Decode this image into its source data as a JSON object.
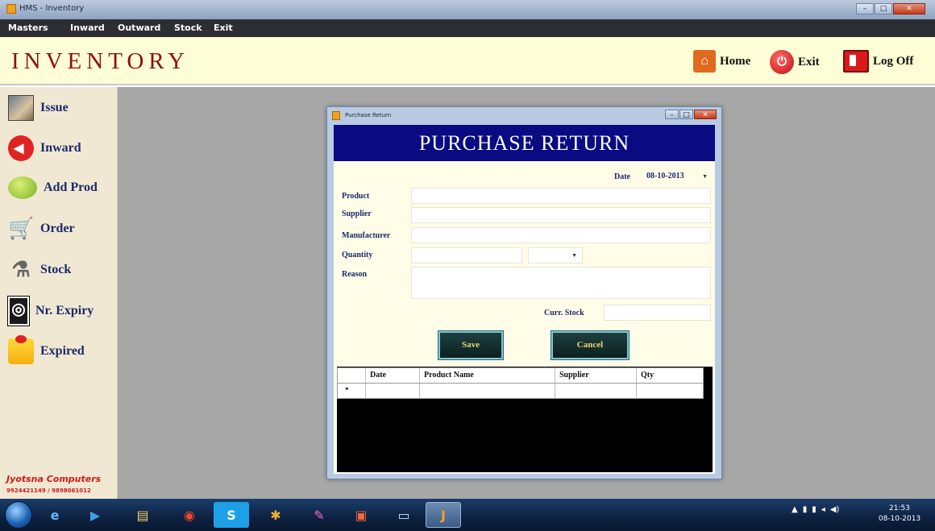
{
  "window": {
    "title": "HMS - Inventory",
    "min": "–",
    "max": "□",
    "close": "✕"
  },
  "menu": [
    "Masters",
    "Inward",
    "Outward",
    "Stock",
    "Exit"
  ],
  "header": {
    "app_title": "INVENTORY",
    "home": "Home",
    "exit": "Exit",
    "logoff": "Log Off"
  },
  "sidebar": {
    "items": [
      {
        "label": "Issue",
        "icon": "issue-icon"
      },
      {
        "label": "Inward",
        "icon": "inward-icon"
      },
      {
        "label": "Add Prod",
        "icon": "add-product-icon"
      },
      {
        "label": "Order",
        "icon": "cart-icon"
      },
      {
        "label": "Stock",
        "icon": "stock-icon"
      },
      {
        "label": "Nr. Expiry",
        "icon": "near-expiry-icon"
      },
      {
        "label": "Expired",
        "icon": "expired-icon"
      }
    ],
    "brand": "Jyotsna Computers",
    "brand_phone": "9924421149 / 9898061012"
  },
  "dialog": {
    "title": "Purchase Return",
    "heading": "PURCHASE RETURN",
    "date_label": "Date",
    "date_value": "08-10-2013",
    "labels": {
      "product": "Product",
      "supplier": "Supplier",
      "manufacturer": "Manufacturer",
      "quantity": "Quantity",
      "reason": "Reason",
      "curr_stock": "Curr. Stock"
    },
    "values": {
      "product": "",
      "supplier": "",
      "manufacturer": "",
      "quantity": "",
      "unit": "",
      "reason": "",
      "curr_stock": ""
    },
    "save": "Save",
    "cancel": "Cancel",
    "grid": {
      "columns": [
        "Date",
        "Product Name",
        "Supplier",
        "Qty"
      ],
      "new_row_marker": "*"
    }
  },
  "taskbar": {
    "apps": [
      {
        "name": "internet-explorer",
        "glyph": "e"
      },
      {
        "name": "media-player",
        "glyph": "▶"
      },
      {
        "name": "file-explorer",
        "glyph": "▤"
      },
      {
        "name": "chrome",
        "glyph": "◉"
      },
      {
        "name": "skype",
        "glyph": "S"
      },
      {
        "name": "network-tool",
        "glyph": "✱"
      },
      {
        "name": "paint",
        "glyph": "✎"
      },
      {
        "name": "powerpoint",
        "glyph": "▣"
      },
      {
        "name": "window-switcher",
        "glyph": "▭"
      },
      {
        "name": "inventory-app",
        "glyph": "J"
      }
    ],
    "tray": [
      "▲",
      "▮",
      "▮",
      "◂",
      "◀)"
    ],
    "time": "21:53",
    "date": "08-10-2013"
  }
}
